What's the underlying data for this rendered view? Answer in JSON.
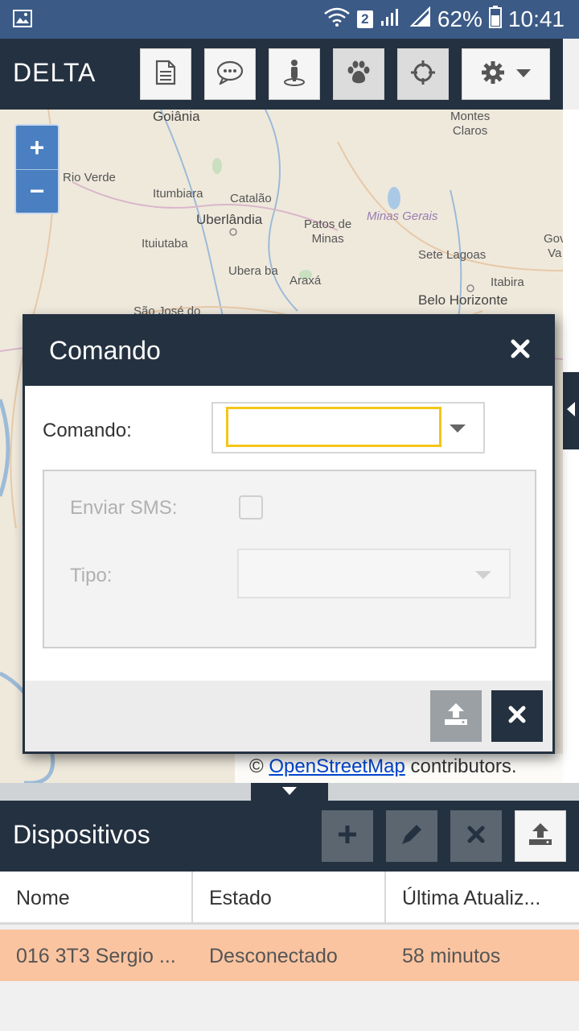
{
  "status_bar": {
    "sim_badge": "2",
    "battery": "62%",
    "time": "10:41"
  },
  "header": {
    "brand": "DELTA"
  },
  "map": {
    "cities": [
      {
        "name": "Goiânia"
      },
      {
        "name": "Montes\nClaros"
      },
      {
        "name": "Rio Verde"
      },
      {
        "name": "Itumbiara"
      },
      {
        "name": "Catalão"
      },
      {
        "name": "Uberlândia"
      },
      {
        "name": "Patos de\nMinas"
      },
      {
        "name": "Minas Gerais"
      },
      {
        "name": "Ituiutaba"
      },
      {
        "name": "Sete Lagoas"
      },
      {
        "name": "Ubera ba"
      },
      {
        "name": "Araxá"
      },
      {
        "name": "Itabira"
      },
      {
        "name": "Belo Horizonte"
      },
      {
        "name": "São José do"
      },
      {
        "name": "Gov\nVa"
      }
    ],
    "zoom_in": "+",
    "zoom_out": "−",
    "attribution_prefix": "© ",
    "attribution_link": "OpenStreetMap",
    "attribution_suffix": " contributors."
  },
  "modal": {
    "title": "Comando",
    "command_label": "Comando:",
    "send_sms_label": "Enviar SMS:",
    "type_label": "Tipo:"
  },
  "devices": {
    "title": "Dispositivos",
    "columns": [
      "Nome",
      "Estado",
      "Última Atualiz..."
    ],
    "rows": [
      [
        "016 3T3 Sergio ...",
        "Desconectado",
        "58 minutos"
      ]
    ]
  }
}
